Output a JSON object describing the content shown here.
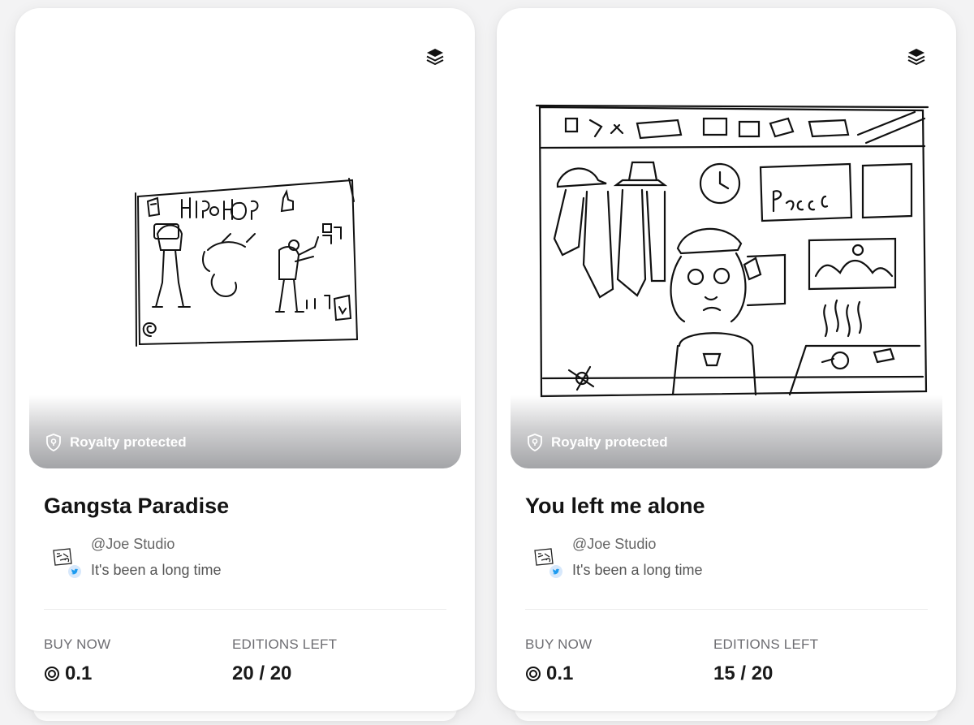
{
  "cards": [
    {
      "image_subject": "hip-hop sketch",
      "royalty_label": "Royalty protected",
      "title": "Gangsta Paradise",
      "creator_handle": "@Joe Studio",
      "creator_bio": "It's been a long time",
      "buy_label": "BUY NOW",
      "price": "0.1",
      "editions_label": "EDITIONS LEFT",
      "editions": "20 / 20"
    },
    {
      "image_subject": "room sketch",
      "royalty_label": "Royalty protected",
      "title": "You left me alone",
      "creator_handle": "@Joe Studio",
      "creator_bio": "It's been a long time",
      "buy_label": "BUY NOW",
      "price": "0.1",
      "editions_label": "EDITIONS LEFT",
      "editions": "15 / 20"
    }
  ],
  "icons": {
    "collection": "layers-icon",
    "royalty": "shield-icon",
    "social": "twitter-icon",
    "currency": "tezos-coin-icon"
  },
  "colors": {
    "card_bg": "#ffffff",
    "page_bg": "#f3f3f4",
    "muted_text": "#6d6d72",
    "twitter_blue": "#1d9bf0"
  }
}
